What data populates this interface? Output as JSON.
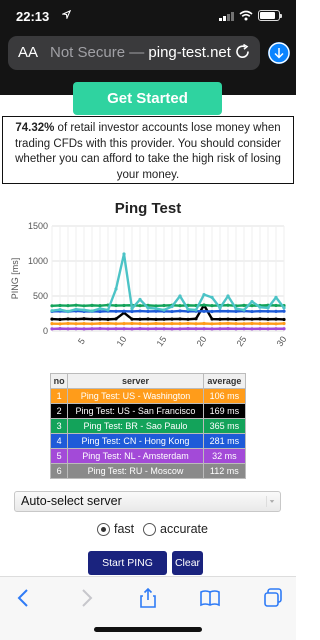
{
  "status_bar": {
    "time": "22:13",
    "location_icon": "location-arrow-icon"
  },
  "browser": {
    "aa_label": "AA",
    "security_label": "Not Secure",
    "separator": " — ",
    "domain": "ping-test.net",
    "reload_icon": "reload-icon",
    "download_icon": "download-icon"
  },
  "ad": {
    "cta_label": "Get Started",
    "risk_percent": "74.32%",
    "risk_text": " of retail investor accounts lose money when trading CFDs with this provider. You should consider whether you can afford to take the high risk of losing your money."
  },
  "chart_title": "Ping Test",
  "chart_data": {
    "type": "line",
    "title": "Ping Test",
    "ylabel": "PING [ms]",
    "ylim": [
      0,
      1500
    ],
    "yticks": [
      "0",
      "500",
      "1000",
      "1500"
    ],
    "xlim": [
      1,
      30
    ],
    "xticks": [
      "5",
      "10",
      "15",
      "20",
      "25",
      "30"
    ],
    "grid": true,
    "x": [
      1,
      2,
      3,
      4,
      5,
      6,
      7,
      8,
      9,
      10,
      11,
      12,
      13,
      14,
      15,
      16,
      17,
      18,
      19,
      20,
      21,
      22,
      23,
      24,
      25,
      26,
      27,
      28,
      29,
      30
    ],
    "series": [
      {
        "name": "Ping Test: US - Washington",
        "color": "#ff9c1a",
        "values": [
          105,
          102,
          108,
          104,
          106,
          103,
          107,
          109,
          104,
          106,
          108,
          105,
          103,
          107,
          104,
          106,
          105,
          108,
          104,
          107,
          103,
          106,
          109,
          105,
          104,
          107,
          105,
          106,
          103,
          108
        ]
      },
      {
        "name": "Ping Test: US - San Francisco",
        "color": "#000000",
        "values": [
          170,
          165,
          172,
          168,
          175,
          168,
          170,
          166,
          173,
          260,
          170,
          168,
          171,
          166,
          168,
          170,
          172,
          167,
          175,
          370,
          171,
          168,
          170,
          166,
          172,
          169,
          173,
          168,
          170,
          165
        ]
      },
      {
        "name": "Ping Test: BR - Sao Paulo",
        "color": "#13a35a",
        "values": [
          360,
          365,
          362,
          368,
          360,
          366,
          362,
          370,
          364,
          365,
          368,
          362,
          366,
          360,
          364,
          368,
          362,
          366,
          364,
          370,
          362,
          365,
          368,
          360,
          366,
          362,
          364,
          368,
          365,
          362
        ]
      },
      {
        "name": "Ping Test: CN - Hong Kong",
        "color": "#1e5bd8",
        "values": [
          280,
          284,
          278,
          286,
          280,
          282,
          278,
          284,
          281,
          283,
          279,
          285,
          280,
          282,
          281,
          278,
          286,
          280,
          283,
          281,
          279,
          284,
          282,
          280,
          285,
          278,
          283,
          281,
          280,
          282
        ]
      },
      {
        "name": "Ping Test: NL - Amsterdam",
        "color": "#a34ad8",
        "values": [
          30,
          34,
          31,
          33,
          30,
          32,
          35,
          31,
          33,
          32,
          30,
          34,
          31,
          33,
          32,
          30,
          31,
          34,
          32,
          33,
          30,
          32,
          34,
          31,
          33,
          30,
          32,
          31,
          33,
          32
        ]
      },
      {
        "name": "Ping Test: RU - Moscow",
        "color": "#4cc3c6",
        "values": [
          290,
          305,
          280,
          310,
          300,
          285,
          320,
          300,
          600,
          1100,
          320,
          450,
          330,
          320,
          300,
          350,
          500,
          310,
          300,
          520,
          480,
          330,
          500,
          320,
          300,
          420,
          340,
          330,
          480,
          330
        ]
      }
    ]
  },
  "results_table": {
    "headers": [
      "no",
      "server",
      "average"
    ],
    "rows": [
      {
        "no": "1",
        "server": "Ping Test: US - Washington",
        "average": "106 ms",
        "color": "#ff9c1a"
      },
      {
        "no": "2",
        "server": "Ping Test: US - San Francisco",
        "average": "169 ms",
        "color": "#000000"
      },
      {
        "no": "3",
        "server": "Ping Test: BR - Sao Paulo",
        "average": "365 ms",
        "color": "#13a35a"
      },
      {
        "no": "4",
        "server": "Ping Test: CN - Hong Kong",
        "average": "281 ms",
        "color": "#1e5bd8"
      },
      {
        "no": "5",
        "server": "Ping Test: NL - Amsterdam",
        "average": "32 ms",
        "color": "#a34ad8"
      },
      {
        "no": "6",
        "server": "Ping Test: RU - Moscow",
        "average": "112 ms",
        "color": "#8a8a8a"
      }
    ]
  },
  "server_select": {
    "selected": "Auto-select server"
  },
  "mode": {
    "fast_label": "fast",
    "accurate_label": "accurate",
    "selected": "fast"
  },
  "buttons": {
    "start_label": "Start PING TEST",
    "clear_label": "Clear"
  },
  "toolbar": {
    "back_icon": "back-chevron-icon",
    "forward_icon": "forward-chevron-icon",
    "share_icon": "share-icon",
    "bookmarks_icon": "bookmarks-icon",
    "tabs_icon": "tabs-icon"
  }
}
